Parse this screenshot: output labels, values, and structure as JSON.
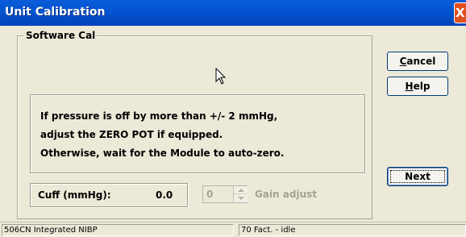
{
  "window": {
    "title": "Unit Calibration",
    "close_label": "X"
  },
  "group": {
    "legend": "Software Cal"
  },
  "message": {
    "lines": [
      "If pressure is off by more than +/- 2 mmHg,",
      "adjust the ZERO POT if equipped.",
      "Otherwise, wait for the Module to auto-zero."
    ]
  },
  "buttons": {
    "cancel": {
      "accel": "C",
      "rest": "ancel"
    },
    "help": {
      "accel": "H",
      "rest": "elp"
    },
    "next": "Next"
  },
  "cuff": {
    "label": "Cuff (mmHg):",
    "value": "0.0"
  },
  "gain": {
    "value": "0",
    "label": "Gain adjust"
  },
  "status": {
    "left": "506CN Integrated NIBP",
    "right": "70 Fact. - idle"
  }
}
